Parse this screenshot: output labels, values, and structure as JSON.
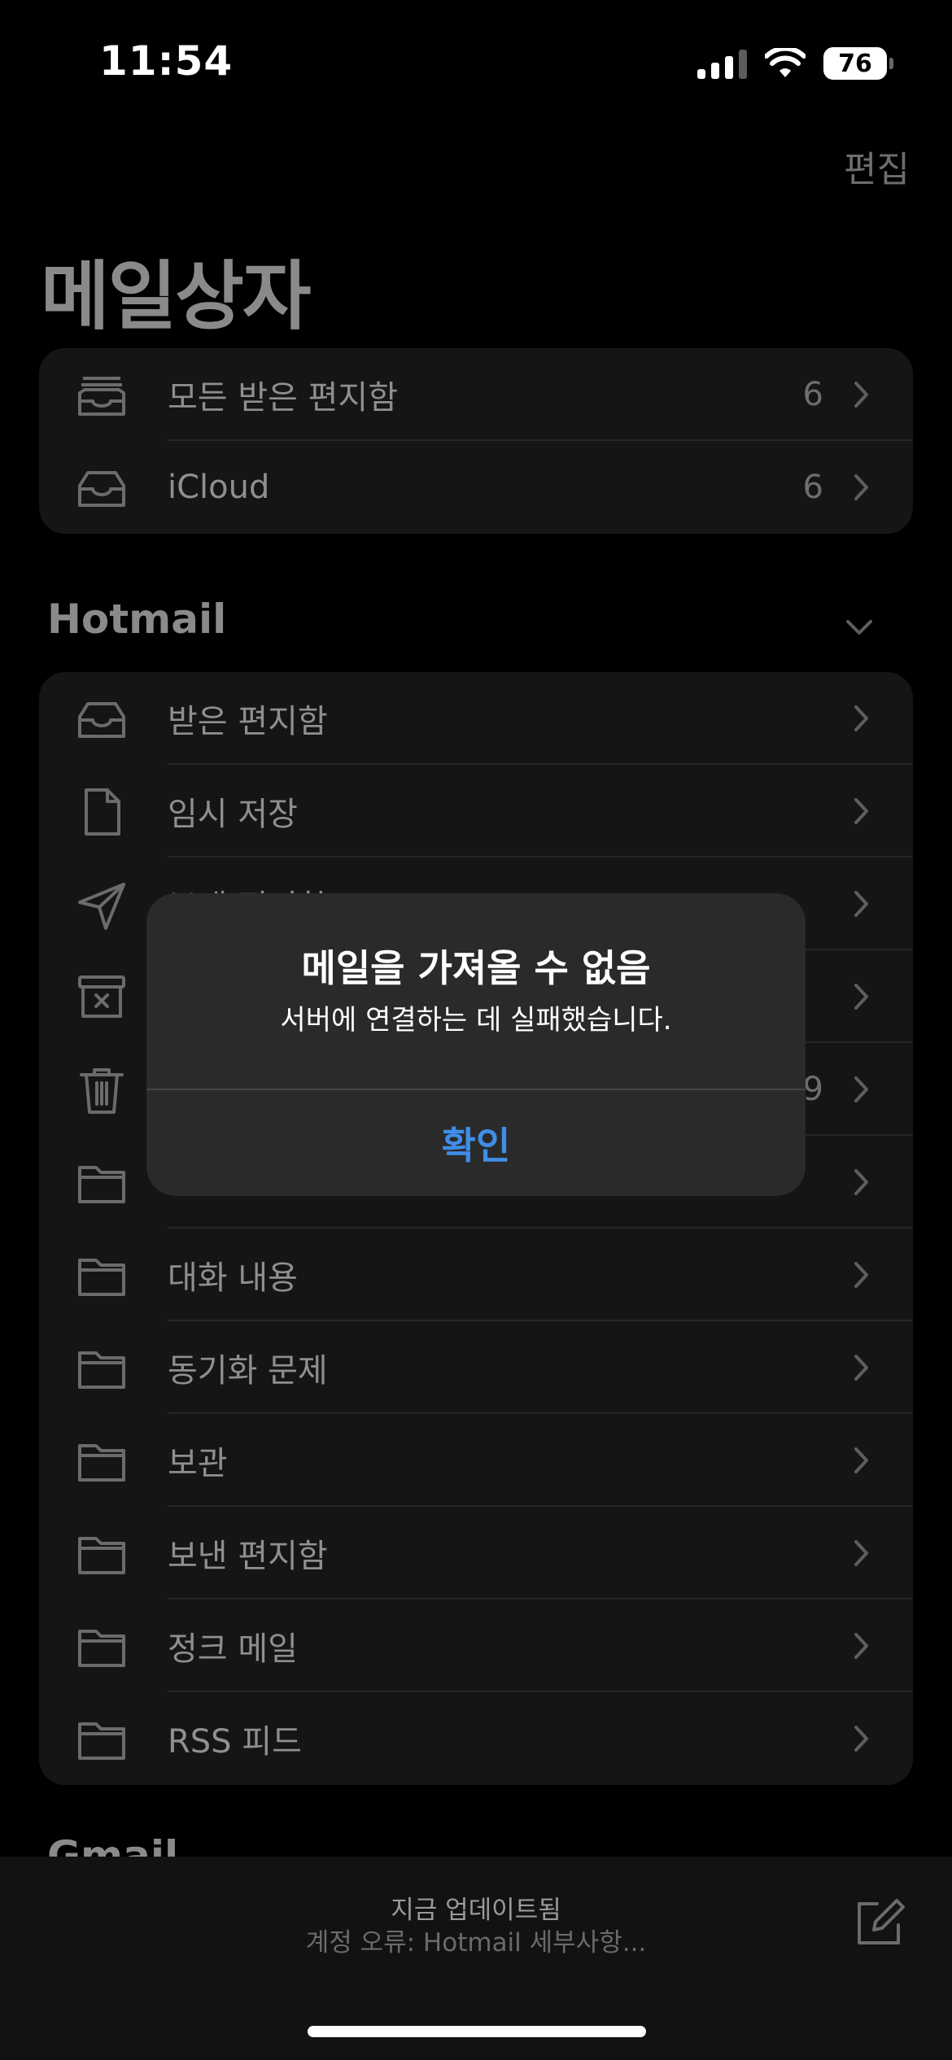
{
  "status": {
    "time": "11:54",
    "battery": "76"
  },
  "nav": {
    "edit": "편집",
    "title": "메일상자"
  },
  "top_mailboxes": [
    {
      "label": "모든 받은 편지함",
      "count": "6",
      "icon": "stacked-inbox-icon"
    },
    {
      "label": "iCloud",
      "count": "6",
      "icon": "inbox-icon"
    }
  ],
  "hotmail": {
    "header": "Hotmail",
    "items": [
      {
        "label": "받은 편지함",
        "count": "",
        "icon": "inbox-icon"
      },
      {
        "label": "임시 저장",
        "count": "",
        "icon": "document-icon"
      },
      {
        "label": "보낸 편지함",
        "count": "",
        "icon": "send-icon"
      },
      {
        "label": "",
        "count": "",
        "icon": "archive-icon"
      },
      {
        "label": "",
        "count": "9",
        "icon": "trash-icon"
      },
      {
        "label": "",
        "count": "",
        "icon": "folder-icon"
      },
      {
        "label": "대화 내용",
        "count": "",
        "icon": "folder-icon"
      },
      {
        "label": "동기화 문제",
        "count": "",
        "icon": "folder-icon"
      },
      {
        "label": "보관",
        "count": "",
        "icon": "folder-icon"
      },
      {
        "label": "보낸 편지함",
        "count": "",
        "icon": "folder-icon"
      },
      {
        "label": "정크 메일",
        "count": "",
        "icon": "folder-icon"
      },
      {
        "label": "RSS 피드",
        "count": "",
        "icon": "folder-icon"
      }
    ]
  },
  "gmail": {
    "header": "Gmail"
  },
  "bottom": {
    "status": "지금 업데이트됨",
    "error": "계정 오류: Hotmail 세부사항..."
  },
  "alert": {
    "title": "메일을 가져올 수 없음",
    "message": "서버에 연결하는 데 실패했습니다.",
    "ok": "확인"
  },
  "colors": {
    "alert_button": "#3f8ee8",
    "background": "#000000"
  }
}
